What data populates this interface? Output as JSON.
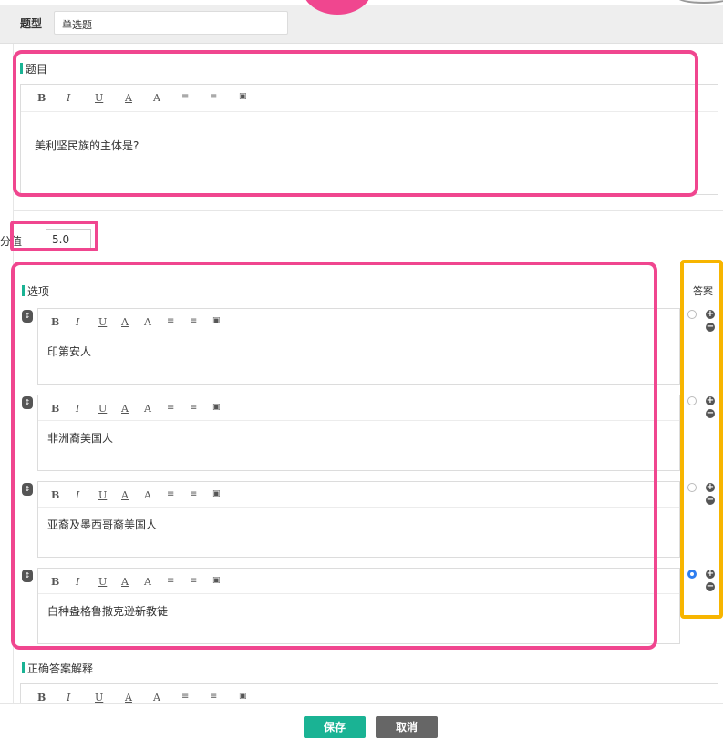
{
  "header": {
    "type_label": "题型",
    "type_value": "单选题"
  },
  "question": {
    "section_label": "题目",
    "text": "美利坚民族的主体是?"
  },
  "score": {
    "label": "分值",
    "value": "5.0"
  },
  "options": {
    "section_label": "选项",
    "answer_label": "答案",
    "items": [
      {
        "text": "印第安人",
        "selected": false
      },
      {
        "text": "非洲裔美国人",
        "selected": false
      },
      {
        "text": "亚裔及墨西哥裔美国人",
        "selected": false
      },
      {
        "text": "白种盎格鲁撒克逊新教徒",
        "selected": true
      }
    ]
  },
  "explanation": {
    "section_label": "正确答案解释"
  },
  "toolbar": {
    "bold": "B",
    "italic": "I",
    "underline": "U",
    "font_color": "A",
    "font_size": "A",
    "ordered_list_icon": "ordered-list-icon",
    "unordered_list_icon": "unordered-list-icon",
    "image_icon": "image-icon"
  },
  "footer": {
    "save_label": "保存",
    "cancel_label": "取消"
  },
  "colors": {
    "accent": "#1ab394",
    "highlight_pink": "#f0468f",
    "highlight_yellow": "#f7b500",
    "radio_selected": "#2e7ef0",
    "cancel_btn": "#666666"
  }
}
